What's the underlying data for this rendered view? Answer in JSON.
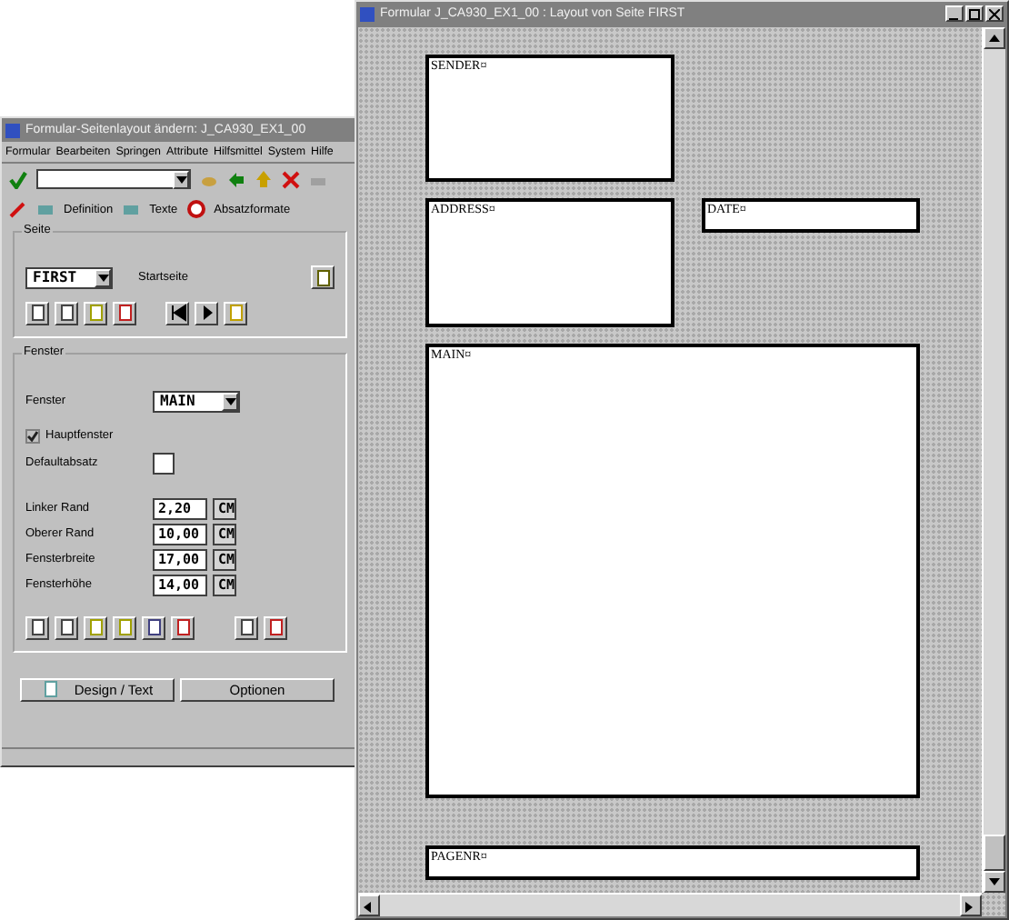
{
  "form_window": {
    "title": "Formular-Seitenlayout ändern: J_CA930_EX1_00",
    "menu": [
      "Formular",
      "Bearbeiten",
      "Springen",
      "Attribute",
      "Hilfsmittel",
      "System",
      "Hilfe"
    ],
    "app_toolbar": [
      "Definition",
      "Texte",
      "Absatzformate"
    ],
    "page_group": {
      "title": "Seite",
      "page": "FIRST",
      "page_label": "Startseite"
    },
    "window_group": {
      "title": "Fenster",
      "window_label": "Fenster",
      "window": "MAIN",
      "main_window": {
        "label": "Hauptfenster",
        "checked": true
      },
      "default_paragraph_label": "Defaultabsatz",
      "fields": [
        {
          "label": "Linker Rand",
          "value": "2,20",
          "unit": "CM"
        },
        {
          "label": "Oberer Rand",
          "value": "10,00",
          "unit": "CM"
        },
        {
          "label": "Fensterbreite",
          "value": "17,00",
          "unit": "CM"
        },
        {
          "label": "Fensterhöhe",
          "value": "14,00",
          "unit": "CM"
        }
      ]
    },
    "buttons": [
      "Design / Text",
      "Optionen"
    ]
  },
  "layout_window": {
    "title": "Formular J_CA930_EX1_00 : Layout von Seite FIRST",
    "windows": [
      {
        "name": "SENDER¤"
      },
      {
        "name": "ADDRESS¤"
      },
      {
        "name": "DATE¤"
      },
      {
        "name": "MAIN¤"
      },
      {
        "name": "PAGENR¤"
      }
    ]
  }
}
